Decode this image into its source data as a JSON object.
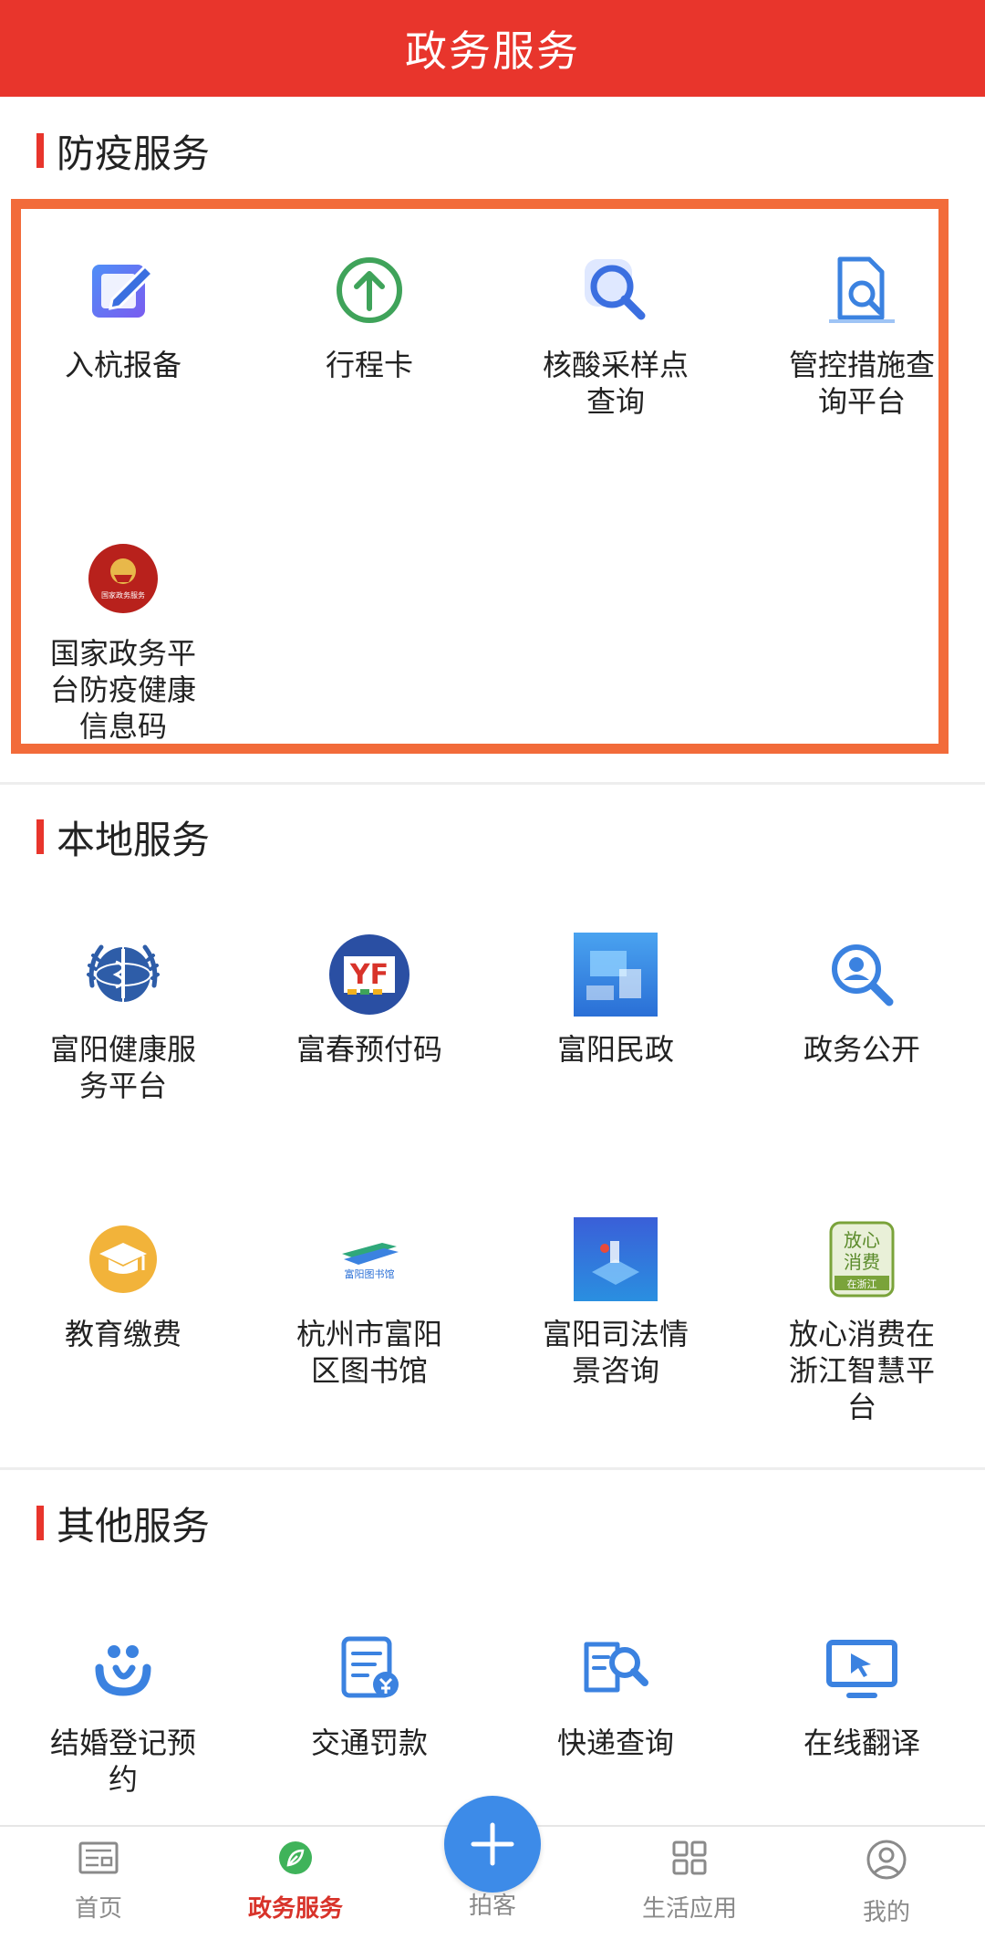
{
  "header": {
    "title": "政务服务"
  },
  "sections": {
    "epidemic": {
      "title": "防疫服务",
      "items": [
        {
          "label": "入杭报备",
          "icon": "edit-square-icon"
        },
        {
          "label": "行程卡",
          "icon": "upload-arrow-icon"
        },
        {
          "label": "核酸采样点查询",
          "icon": "magnifier-icon"
        },
        {
          "label": "管控措施查询平台",
          "icon": "document-search-icon"
        },
        {
          "label": "国家政务平台防疫健康信息码",
          "icon": "national-emblem-icon",
          "badge_text": "国家政务服务"
        }
      ]
    },
    "local": {
      "title": "本地服务",
      "items": [
        {
          "label": "富阳健康服务平台",
          "icon": "who-emblem-icon"
        },
        {
          "label": "富春预付码",
          "icon": "yf-logo-icon",
          "logo_text": "YF"
        },
        {
          "label": "富阳民政",
          "icon": "civil-affairs-illustration-icon"
        },
        {
          "label": "政务公开",
          "icon": "user-search-icon"
        },
        {
          "label": "教育缴费",
          "icon": "graduation-cap-icon"
        },
        {
          "label": "杭州市富阳区图书馆",
          "icon": "library-logo-icon",
          "logo_text": "富阳图书馆"
        },
        {
          "label": "富阳司法情景咨询",
          "icon": "justice-illustration-icon"
        },
        {
          "label": "放心消费在浙江智慧平台",
          "icon": "consumer-badge-icon",
          "logo_lines": [
            "放心",
            "消费",
            "在浙江"
          ]
        }
      ]
    },
    "other": {
      "title": "其他服务",
      "items": [
        {
          "label": "结婚登记预约",
          "icon": "marriage-icon"
        },
        {
          "label": "交通罚款",
          "icon": "traffic-fine-icon"
        },
        {
          "label": "快递查询",
          "icon": "express-search-icon"
        },
        {
          "label": "在线翻译",
          "icon": "monitor-cursor-icon"
        }
      ]
    }
  },
  "tabbar": {
    "items": [
      {
        "label": "首页",
        "icon": "newspaper-icon"
      },
      {
        "label": "政务服务",
        "icon": "leaf-icon",
        "active": true
      },
      {
        "label": "拍客",
        "icon": "plus-icon"
      },
      {
        "label": "生活应用",
        "icon": "grid-icon"
      },
      {
        "label": "我的",
        "icon": "profile-icon"
      }
    ]
  },
  "colors": {
    "brand_red": "#e8352c",
    "highlight_orange": "#f26b3a",
    "fab_blue": "#3d8be8"
  }
}
